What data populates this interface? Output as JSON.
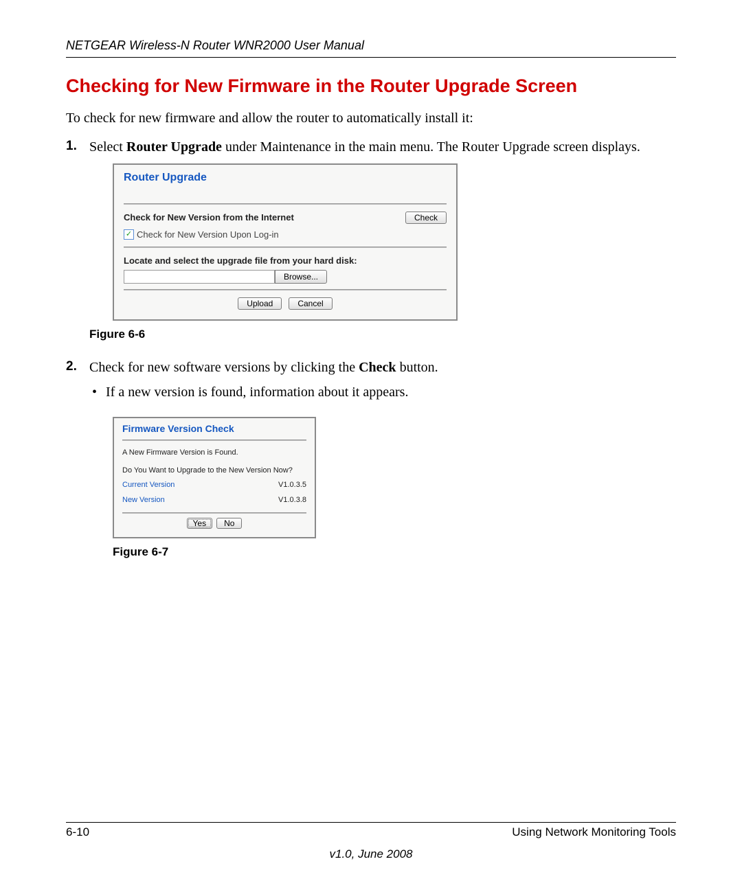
{
  "header": {
    "running": "NETGEAR Wireless-N Router WNR2000 User Manual"
  },
  "title": "Checking for New Firmware in the Router Upgrade Screen",
  "intro": "To check for new firmware and allow the router to automatically install it:",
  "steps": {
    "s1_a": "Select ",
    "s1_bold": "Router Upgrade",
    "s1_b": " under Maintenance in the main menu. The Router Upgrade screen displays.",
    "s2_a": "Check for new software versions by clicking the ",
    "s2_bold": "Check",
    "s2_b": " button.",
    "s2_bullet": "If a new version is found, information about it appears."
  },
  "fig1": {
    "caption": "Figure 6-6",
    "title": "Router Upgrade",
    "check_label": "Check for New Version from the Internet",
    "check_btn": "Check",
    "checkbox_label": "Check for New Version Upon Log-in",
    "locate_label": "Locate and select the upgrade file from your hard disk:",
    "browse_btn": "Browse...",
    "upload_btn": "Upload",
    "cancel_btn": "Cancel"
  },
  "fig2": {
    "caption": "Figure 6-7",
    "title": "Firmware Version Check",
    "found": "A New Firmware Version is Found.",
    "prompt": "Do You Want to Upgrade to the New Version Now?",
    "cur_label": "Current Version",
    "cur_val": "V1.0.3.5",
    "new_label": "New Version",
    "new_val": "V1.0.3.8",
    "yes": "Yes",
    "no": "No"
  },
  "footer": {
    "page": "6-10",
    "section": "Using Network Monitoring Tools",
    "version": "v1.0, June 2008"
  }
}
